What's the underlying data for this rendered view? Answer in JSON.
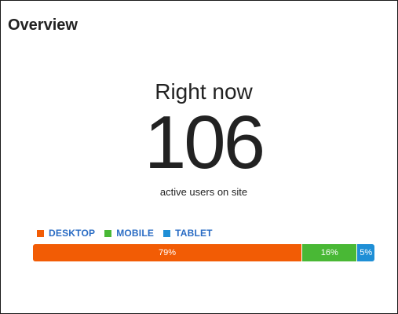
{
  "widget": {
    "title": "Overview",
    "headline": "Right now",
    "active_count": "106",
    "subline": "active users on site"
  },
  "devices": [
    {
      "label": "DESKTOP",
      "value": "79%",
      "share": 79,
      "color": "#f25c05"
    },
    {
      "label": "MOBILE",
      "value": "16%",
      "share": 16,
      "color": "#49b835"
    },
    {
      "label": "TABLET",
      "value": "5%",
      "share": 5,
      "color": "#1f8fd6"
    }
  ],
  "colors": {
    "legend_text": "#2a6cc4",
    "border": "#1a1a1a"
  }
}
